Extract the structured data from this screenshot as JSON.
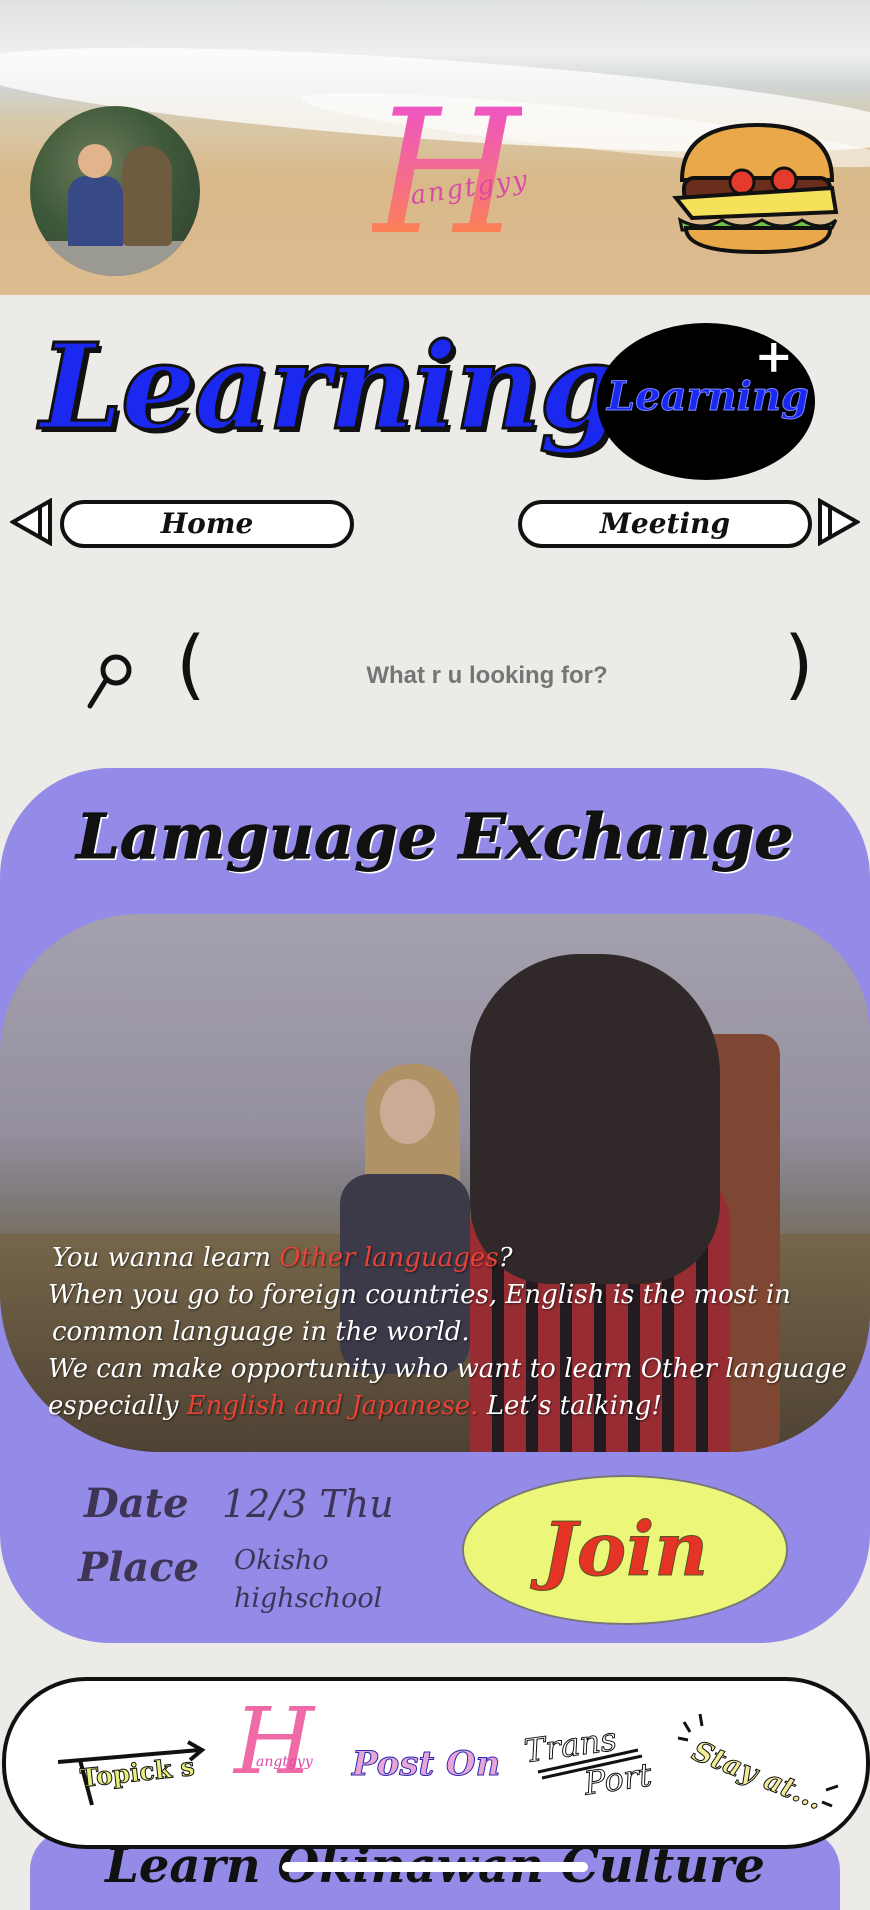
{
  "header": {
    "logo_letter": "H",
    "logo_text": "angtgyy"
  },
  "main": {
    "title": "Learning",
    "learning_plus_label": "Learning",
    "learning_plus_symbol": "+"
  },
  "nav": {
    "home_label": "Home",
    "meeting_label": "Meeting"
  },
  "search": {
    "open_paren": "(",
    "close_paren": ")",
    "placeholder": "What r u looking for?"
  },
  "event": {
    "title": "Lamguage Exchange",
    "desc_line1_a": "You wanna learn ",
    "desc_line1_hl": "Other languages",
    "desc_line1_b": "?",
    "desc_line2": "When you go to foreign countries, English is the most in",
    "desc_line3": "common language in the world.",
    "desc_line4": "We can make opportunity who want to learn Other language",
    "desc_line5_a": "especially ",
    "desc_line5_hl": "English and Japanese.",
    "desc_line5_b": "  Let’s talking!",
    "date_label": "Date",
    "date_value": "12/3 Thu",
    "place_label": "Place",
    "place_value": "Okisho highschool",
    "join_label": "Join"
  },
  "tabs": {
    "topicks": "Topick s",
    "home_logo_letter": "H",
    "home_logo_text": "angtgyy",
    "post_on": "Post On",
    "transport_top": "Trans",
    "transport_bottom": "Port",
    "stay_at": "Stay at..."
  },
  "next_section": {
    "title": "Learn Okinawan Culture"
  },
  "colors": {
    "learning_blue": "#1b28f0",
    "card_purple": "#948be8",
    "join_yellow": "#ecf77a",
    "join_red": "#e53426",
    "highlight_red": "#e94236"
  }
}
